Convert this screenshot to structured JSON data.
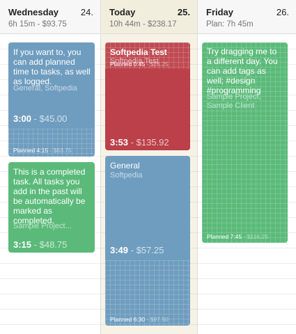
{
  "columns": [
    {
      "day": "Wednesday",
      "date": "24.",
      "summary": "6h 15m - $93.75",
      "tasks": [
        {
          "title": "If you want to, you can add planned time to tasks, as well as logged.",
          "subtitle": "General, Softpedia",
          "time": "3:00",
          "amount": "$45.00",
          "planned_label": "Planned 4:15",
          "planned_amount": "$63.75",
          "color": "#6f9dbf"
        },
        {
          "title": "This is a completed task. All tasks you add in the past will be automatically be marked as completed.",
          "subtitle": "Sample Project...",
          "time": "3:15",
          "amount": "$48.75",
          "color": "#5bba7a"
        }
      ]
    },
    {
      "day": "Today",
      "date": "25.",
      "summary": "10h 44m - $238.17",
      "tasks": [
        {
          "title": "Softpedia Test",
          "subtitle": "Softpedia Test",
          "planned_label": "Planned 0:45",
          "planned_amount": "$26.25",
          "time": "3:53",
          "amount": "$135.92",
          "color": "#bb4049"
        },
        {
          "title": "General",
          "subtitle": "Softpedia",
          "time": "3:49",
          "amount": "$57.25",
          "planned_label": "Planned 6:30",
          "planned_amount": "$97.50",
          "color": "#6f9dbf"
        }
      ]
    },
    {
      "day": "Friday",
      "date": "26.",
      "summary": "Plan: 7h 45m",
      "tasks": [
        {
          "title": "Try dragging me to a different day. You can add tags as well; #design #programming",
          "subtitle": "Sample Project, Sample Client",
          "planned_label": "Planned 7:45",
          "planned_amount": "$116.25",
          "color": "#5bba7a"
        }
      ]
    }
  ],
  "separator": "-"
}
